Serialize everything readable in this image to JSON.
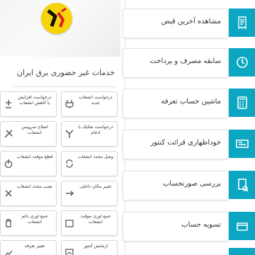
{
  "app": {
    "title": "خدمات غیر حضوری برق ایران",
    "accent": "#0aa6c2",
    "logo_color": "#f6d40a"
  },
  "left_grid": [
    {
      "label": "درخواست افزایش یا کاهش انشعاب",
      "icon": "plus-minus-icon"
    },
    {
      "label": "درخواست انشعاب جدید",
      "icon": "plug-icon"
    },
    {
      "label": "اصلاح سرویس انشعاب",
      "icon": "tools-icon"
    },
    {
      "label": "درخواست تفکیک یا ادغام",
      "icon": "merge-icon"
    },
    {
      "label": "قطع موقت انشعاب",
      "icon": "power-off-icon"
    },
    {
      "label": "وصل مجدد انشعاب",
      "icon": "reconnect-icon"
    },
    {
      "label": "نصب مجدد انشعاب",
      "icon": "reinstall-icon"
    },
    {
      "label": "تغییر مکان داخلی",
      "icon": "move-icon"
    },
    {
      "label": "جمع آوری دائم انشعاب",
      "icon": "trash-icon"
    },
    {
      "label": "جمع آوری موقت انشعاب",
      "icon": "box-icon"
    },
    {
      "label": "تغییر تعرفه",
      "icon": "tariff-icon"
    },
    {
      "label": "آزمایش کنتور",
      "icon": "meter-test-icon"
    }
  ],
  "right_menu": [
    {
      "label": "مشاهده آخرین قبض",
      "icon": "bill-icon"
    },
    {
      "label": "سابقه مصرف و پرداخت",
      "icon": "history-icon"
    },
    {
      "label": "ماشین حساب تعرفه",
      "icon": "calculator-icon"
    },
    {
      "label": "خوداظهاری قرائت کنتور",
      "icon": "meter-reading-icon"
    },
    {
      "label": "بررسی صورتحساب",
      "icon": "bill-review-icon"
    },
    {
      "label": "تسویه حساب",
      "icon": "settlement-icon"
    }
  ]
}
